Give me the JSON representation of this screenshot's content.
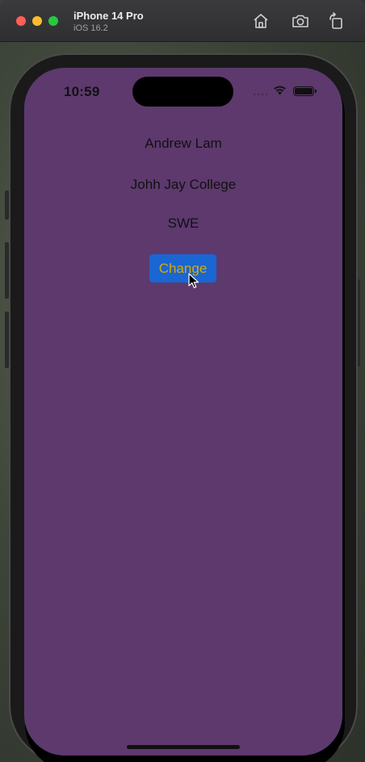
{
  "window": {
    "device_name": "iPhone 14 Pro",
    "os_version": "iOS 16.2"
  },
  "status_bar": {
    "time": "10:59"
  },
  "content": {
    "name": "Andrew Lam",
    "school": "Johh Jay College",
    "role": "SWE"
  },
  "change_button": {
    "label": "Change"
  },
  "colors": {
    "screen_background": "#5d396d",
    "button_background": "#1a66d2",
    "button_text": "#d7a90b",
    "text": "#111111"
  },
  "icons": {
    "home": "home-icon",
    "screenshot": "camera-icon",
    "rotate": "rotate-icon"
  }
}
